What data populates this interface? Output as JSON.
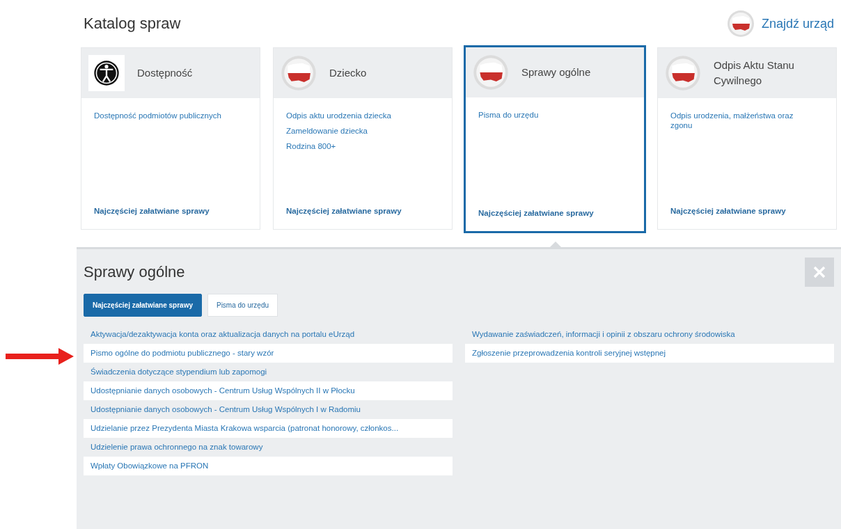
{
  "page_title": "Katalog spraw",
  "find_office": {
    "label": "Znajdź urząd"
  },
  "cards": [
    {
      "title": "Dostępność",
      "kind": "accessibility",
      "selected": false,
      "links": [
        "Dostępność podmiotów publicznych"
      ],
      "footer": "Najczęściej załatwiane sprawy"
    },
    {
      "title": "Dziecko",
      "kind": "flag",
      "selected": false,
      "links": [
        "Odpis aktu urodzenia dziecka",
        "Zameldowanie dziecka",
        "Rodzina 800+"
      ],
      "footer": "Najczęściej załatwiane sprawy"
    },
    {
      "title": "Sprawy ogólne",
      "kind": "flag",
      "selected": true,
      "links": [
        "Pisma do urzędu"
      ],
      "footer": "Najczęściej załatwiane sprawy"
    },
    {
      "title": "Odpis Aktu Stanu Cywilnego",
      "kind": "flag",
      "selected": false,
      "links": [
        "Odpis urodzenia, małżeństwa oraz zgonu"
      ],
      "footer": "Najczęściej załatwiane sprawy"
    }
  ],
  "panel": {
    "title": "Sprawy ogólne",
    "tabs": [
      {
        "label": "Najczęściej załatwiane sprawy",
        "selected": true
      },
      {
        "label": "Pisma do urzędu",
        "selected": false
      }
    ],
    "columns": [
      [
        "Aktywacja/dezaktywacja konta oraz aktualizacja danych na portalu eUrząd",
        "Pismo ogólne do podmiotu publicznego - stary wzór",
        "Świadczenia dotyczące stypendium lub zapomogi",
        "Udostępnianie danych osobowych - Centrum Usług Wspólnych II w Płocku",
        "Udostępnianie danych osobowych - Centrum Usług Wspólnych I w Radomiu",
        "Udzielanie przez Prezydenta Miasta Krakowa wsparcia (patronat honorowy, członkos...",
        "Udzielenie prawa ochronnego na znak towarowy",
        "Wpłaty Obowiązkowe na PFRON"
      ],
      [
        "Wydawanie zaświadczeń, informacji i opinii z obszaru ochrony środowiska",
        "Zgłoszenie przeprowadzenia kontroli seryjnej wstępnej"
      ]
    ]
  }
}
